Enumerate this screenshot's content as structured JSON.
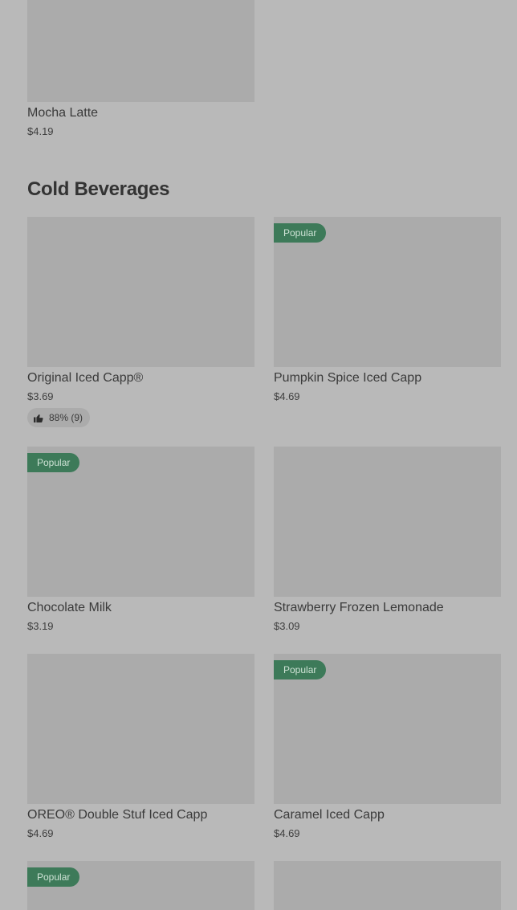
{
  "prev_section": {
    "items": [
      {
        "name": "Mocha Latte",
        "price": "$4.19",
        "badge": ""
      }
    ]
  },
  "cold_beverages": {
    "title": "Cold Beverages",
    "items": [
      {
        "name": "Original Iced Capp®",
        "price": "$3.69",
        "badge": "",
        "rating": "88% (9)"
      },
      {
        "name": "Pumpkin Spice Iced Capp",
        "price": "$4.69",
        "badge": "Popular"
      },
      {
        "name": "Chocolate Milk",
        "price": "$3.19",
        "badge": "Popular"
      },
      {
        "name": "Strawberry Frozen Lemonade",
        "price": "$3.09",
        "badge": ""
      },
      {
        "name": "OREO® Double Stuf Iced Capp",
        "price": "$4.69",
        "badge": ""
      },
      {
        "name": "Caramel Iced Capp",
        "price": "$4.69",
        "badge": "Popular"
      },
      {
        "name": "",
        "price": "",
        "badge": "Popular"
      },
      {
        "name": "",
        "price": "",
        "badge": ""
      }
    ]
  },
  "colors": {
    "background": "#b9b9b9",
    "image_placeholder": "#ababab",
    "badge_bg": "#3d7a59",
    "badge_text": "#cfe3d6"
  },
  "icons": {
    "rating": "thumbs-up-icon"
  }
}
